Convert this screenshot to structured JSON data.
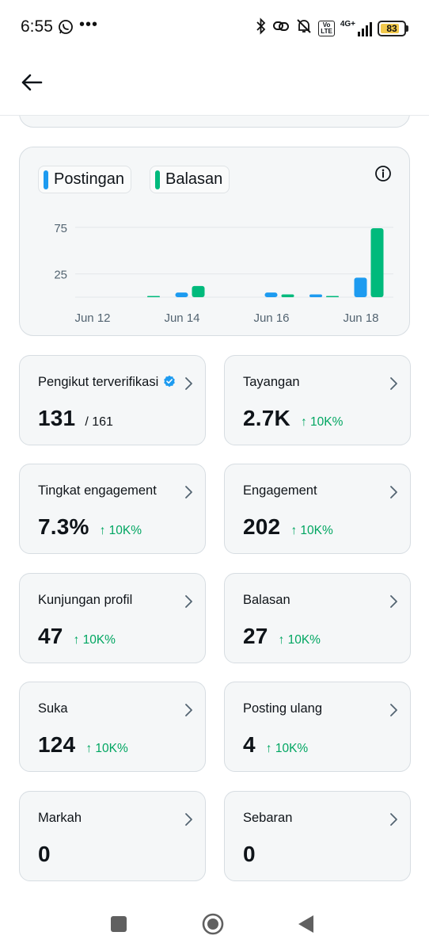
{
  "status_bar": {
    "time": "6:55",
    "battery": "83",
    "battery_fraction": 0.83,
    "volte": "Vo\nLTE",
    "network": "4G+"
  },
  "header": {
    "back_icon": "arrow-left-icon"
  },
  "chart": {
    "legend": [
      {
        "label": "Postingan",
        "color": "#1d9bf0"
      },
      {
        "label": "Balasan",
        "color": "#00ba7c"
      }
    ],
    "info_icon": "info-icon"
  },
  "chart_data": {
    "type": "bar",
    "categories": [
      "Jun 12",
      "Jun 13",
      "Jun 14",
      "Jun 15",
      "Jun 16",
      "Jun 17",
      "Jun 18"
    ],
    "x_tick_labels": [
      "Jun 12",
      "Jun 14",
      "Jun 16",
      "Jun 18"
    ],
    "y_tick_labels": [
      "75",
      "25"
    ],
    "ylim": [
      0,
      80
    ],
    "grid": true,
    "series": [
      {
        "name": "Postingan",
        "color": "#1d9bf0",
        "values": [
          0,
          0,
          5,
          0,
          5,
          3,
          21
        ]
      },
      {
        "name": "Balasan",
        "color": "#00ba7c",
        "values": [
          0,
          1,
          12,
          0,
          3,
          1,
          74
        ]
      }
    ]
  },
  "metrics": [
    {
      "title": "Pengikut terverifikasi",
      "value": "131",
      "sub": "/ 161",
      "change": "",
      "verified": true
    },
    {
      "title": "Tayangan",
      "value": "2.7K",
      "sub": "",
      "change": "↑ 10K%",
      "verified": false
    },
    {
      "title": "Tingkat engagement",
      "value": "7.3%",
      "sub": "",
      "change": "↑ 10K%",
      "verified": false
    },
    {
      "title": "Engagement",
      "value": "202",
      "sub": "",
      "change": "↑ 10K%",
      "verified": false
    },
    {
      "title": "Kunjungan profil",
      "value": "47",
      "sub": "",
      "change": "↑ 10K%",
      "verified": false
    },
    {
      "title": "Balasan",
      "value": "27",
      "sub": "",
      "change": "↑ 10K%",
      "verified": false
    },
    {
      "title": "Suka",
      "value": "124",
      "sub": "",
      "change": "↑ 10K%",
      "verified": false
    },
    {
      "title": "Posting ulang",
      "value": "4",
      "sub": "",
      "change": "↑ 10K%",
      "verified": false
    },
    {
      "title": "Markah",
      "value": "0",
      "sub": "",
      "change": "",
      "verified": false
    },
    {
      "title": "Sebaran",
      "value": "0",
      "sub": "",
      "change": "",
      "verified": false
    }
  ],
  "colors": {
    "accent_blue": "#1d9bf0",
    "accent_green": "#00ba7c",
    "change_green": "#00a661",
    "card_bg": "#f5f7f8",
    "card_border": "#d7dde2"
  }
}
